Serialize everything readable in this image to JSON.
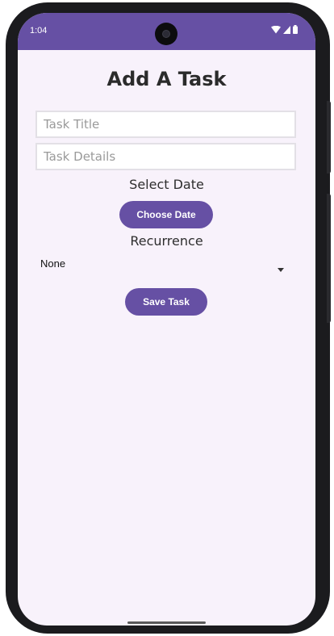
{
  "status_bar": {
    "time": "1:04",
    "background_color": "#6650a4",
    "icons": [
      "wifi-icon",
      "signal-icon",
      "battery-icon"
    ]
  },
  "page": {
    "title": "Add A Task",
    "background_color": "#f8f2fb"
  },
  "form": {
    "task_title": {
      "value": "",
      "placeholder": "Task Title"
    },
    "task_details": {
      "value": "",
      "placeholder": "Task Details"
    },
    "date_section_label": "Select Date",
    "choose_date_button": "Choose Date",
    "recurrence_section_label": "Recurrence",
    "recurrence_selected": "None",
    "save_button": "Save Task"
  },
  "accent_color": "#6650a4"
}
